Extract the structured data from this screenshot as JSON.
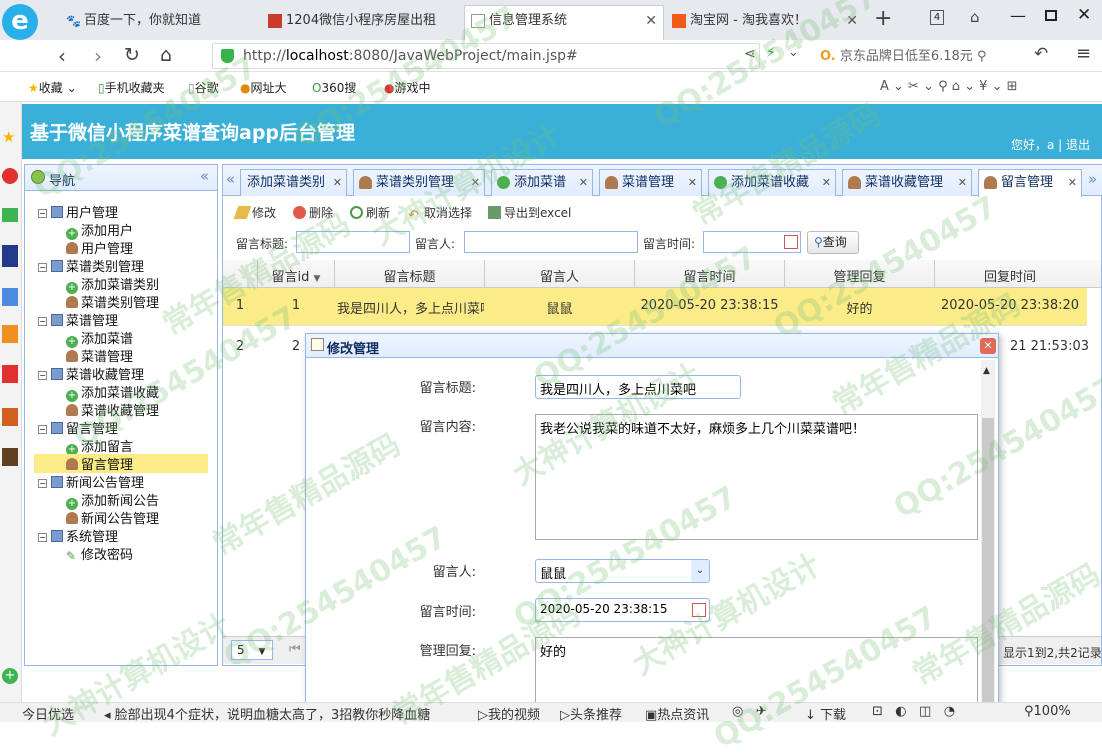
{
  "browser": {
    "tabs": [
      {
        "label": "百度一下，你就知道",
        "active": false
      },
      {
        "label": "1204微信小程序房屋出租",
        "active": false
      },
      {
        "label": "信息管理系统",
        "active": true
      },
      {
        "label": "淘宝网 - 淘我喜欢！",
        "active": false
      }
    ],
    "new_tab": "+",
    "tab_count": "4",
    "url_scheme": "http://",
    "url_host": "localhost",
    "url_rest": ":8080/JavaWebProject/main.jsp#",
    "search_hint": "京东品牌日低至6.18元",
    "bookmarks": [
      "收藏",
      "手机收藏夹",
      "谷歌",
      "网址大",
      "360搜",
      "游戏中"
    ]
  },
  "app": {
    "title": "基于微信小程序菜谱查询app后台管理",
    "welcome": "您好，a | 退出",
    "nav_title": "导航"
  },
  "tree": [
    {
      "label": "用户管理",
      "level": 0
    },
    {
      "label": "添加用户",
      "level": 1,
      "icon": "add"
    },
    {
      "label": "用户管理",
      "level": 1,
      "icon": "user"
    },
    {
      "label": "菜谱类别管理",
      "level": 0
    },
    {
      "label": "添加菜谱类别",
      "level": 1,
      "icon": "add"
    },
    {
      "label": "菜谱类别管理",
      "level": 1,
      "icon": "user"
    },
    {
      "label": "菜谱管理",
      "level": 0
    },
    {
      "label": "添加菜谱",
      "level": 1,
      "icon": "add"
    },
    {
      "label": "菜谱管理",
      "level": 1,
      "icon": "user"
    },
    {
      "label": "菜谱收藏管理",
      "level": 0
    },
    {
      "label": "添加菜谱收藏",
      "level": 1,
      "icon": "add"
    },
    {
      "label": "菜谱收藏管理",
      "level": 1,
      "icon": "user"
    },
    {
      "label": "留言管理",
      "level": 0
    },
    {
      "label": "添加留言",
      "level": 1,
      "icon": "add"
    },
    {
      "label": "留言管理",
      "level": 1,
      "icon": "user",
      "selected": true
    },
    {
      "label": "新闻公告管理",
      "level": 0
    },
    {
      "label": "添加新闻公告",
      "level": 1,
      "icon": "add"
    },
    {
      "label": "新闻公告管理",
      "level": 1,
      "icon": "user"
    },
    {
      "label": "系统管理",
      "level": 0
    },
    {
      "label": "修改密码",
      "level": 1,
      "icon": "pen"
    }
  ],
  "main_tabs": [
    {
      "label": "添加菜谱类别",
      "active": false
    },
    {
      "label": "菜谱类别管理",
      "active": false
    },
    {
      "label": "添加菜谱",
      "active": false
    },
    {
      "label": "菜谱管理",
      "active": false
    },
    {
      "label": "添加菜谱收藏",
      "active": false
    },
    {
      "label": "菜谱收藏管理",
      "active": false
    },
    {
      "label": "留言管理",
      "active": true
    }
  ],
  "toolbar": {
    "edit": "修改",
    "delete": "删除",
    "refresh": "刷新",
    "unselect": "取消选择",
    "export": "导出到excel"
  },
  "filters": {
    "title_label": "留言标题:",
    "author_label": "留言人:",
    "time_label": "留言时间:",
    "query": "查询"
  },
  "grid": {
    "columns": [
      "留言id",
      "留言标题",
      "留言人",
      "留言时间",
      "管理回复",
      "回复时间"
    ],
    "rows": [
      {
        "num": "1",
        "id": "1",
        "title": "我是四川人，多上点川菜吧",
        "author": "鼠鼠",
        "time": "2020-05-20 23:38:15",
        "reply": "好的",
        "reply_time": "2020-05-20 23:38:20"
      },
      {
        "num": "2",
        "id": "2",
        "title": "",
        "author": "",
        "time": "",
        "reply": "",
        "reply_time": "21 21:53:03"
      }
    ]
  },
  "pager": {
    "page_size": "5",
    "summary": "显示1到2,共2记录"
  },
  "dialog": {
    "title": "修改管理",
    "fields": {
      "title_label": "留言标题:",
      "title_value": "我是四川人，多上点川菜吧",
      "content_label": "留言内容:",
      "content_value": "我老公说我菜的味道不太好，麻烦多上几个川菜菜谱吧！",
      "author_label": "留言人:",
      "author_value": "鼠鼠",
      "time_label": "留言时间:",
      "time_value": "2020-05-20 23:38:15",
      "reply_label": "管理回复:",
      "reply_value": "好的"
    }
  },
  "statusbar": {
    "left": "今日优选",
    "news": "脸部出现4个症状，说明血糖太高了，3招教你秒降血糖",
    "video": "我的视频",
    "toutiao": "头条推荐",
    "hot": "热点资讯",
    "download": "下载",
    "zoom": "100%"
  },
  "watermarks": [
    "QQ:254540457",
    "常年售精品源码",
    "大神计算机设计"
  ]
}
